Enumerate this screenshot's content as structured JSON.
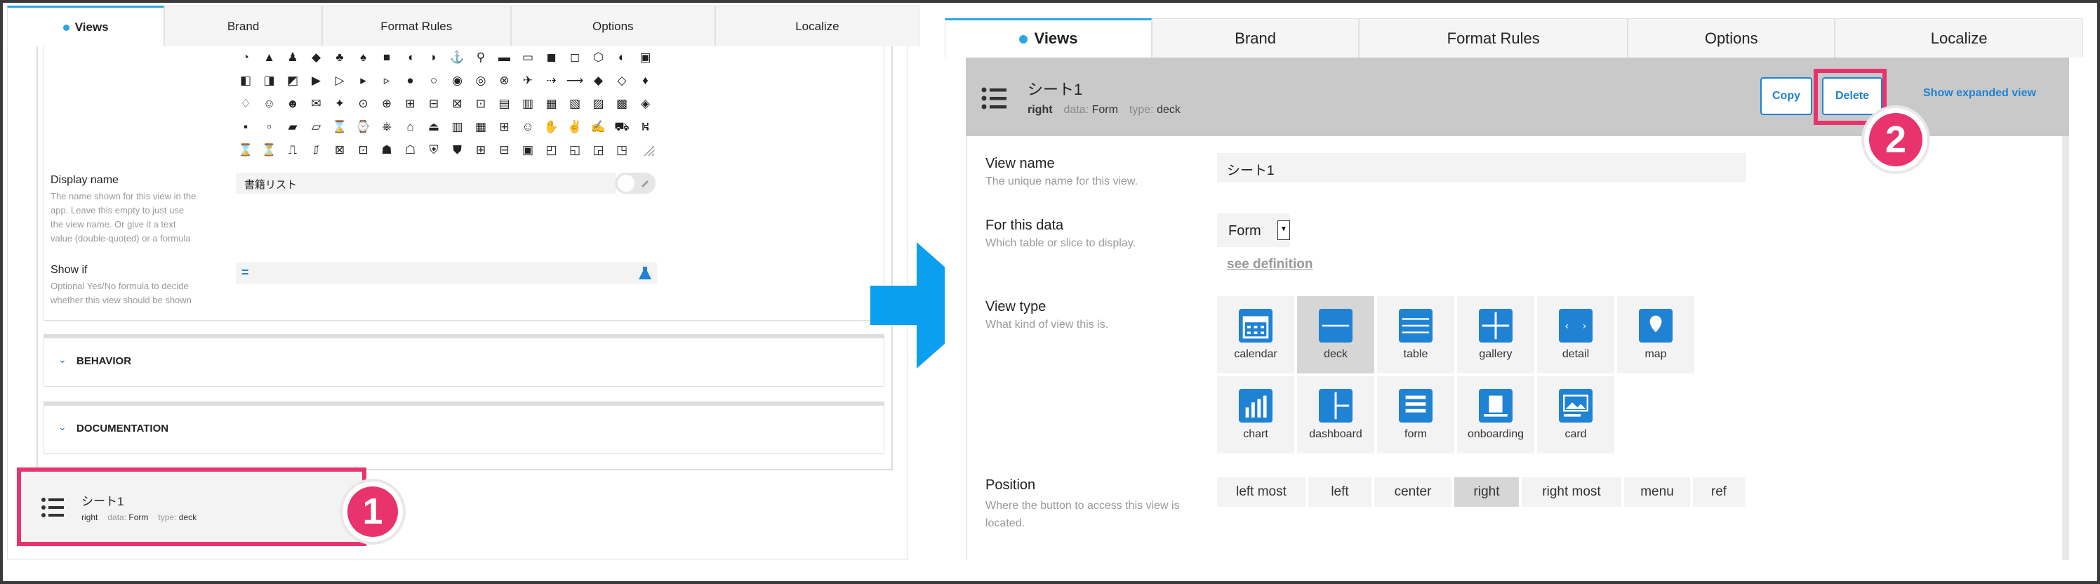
{
  "left": {
    "tabs": [
      {
        "label": "Views"
      },
      {
        "label": "Brand"
      },
      {
        "label": "Format Rules"
      },
      {
        "label": "Options"
      },
      {
        "label": "Localize"
      }
    ],
    "display_name": {
      "label": "Display name",
      "hint": "The name shown for this view in the app. Leave this empty to just use the view name. Or give it a text value (double-quoted) or a formula",
      "value": "書籍リスト"
    },
    "show_if": {
      "label": "Show if",
      "hint": "Optional Yes/No formula to decide whether this view should be shown",
      "eq": "="
    },
    "behavior": {
      "label": "BEHAVIOR"
    },
    "documentation": {
      "label": "DOCUMENTATION"
    },
    "view_item": {
      "title": "シート1",
      "position": "right",
      "data_label": "data:",
      "data_value": "Form",
      "type_label": "type:",
      "type_value": "deck"
    },
    "callout_number": "1"
  },
  "right": {
    "tabs": [
      {
        "label": "Views"
      },
      {
        "label": "Brand"
      },
      {
        "label": "Format Rules"
      },
      {
        "label": "Options"
      },
      {
        "label": "Localize"
      }
    ],
    "header": {
      "title": "シート1",
      "position": "right",
      "data_label": "data:",
      "data_value": "Form",
      "type_label": "type:",
      "type_value": "deck",
      "copy": "Copy",
      "delete": "Delete",
      "expanded": "Show expanded view"
    },
    "view_name": {
      "label": "View name",
      "hint": "The unique name for this view.",
      "value": "シート1"
    },
    "for_this_data": {
      "label": "For this data",
      "hint": "Which table or slice to display.",
      "value": "Form",
      "link": "see definition"
    },
    "view_type": {
      "label": "View type",
      "hint": "What kind of view this is.",
      "selected": "deck",
      "options": [
        {
          "label": "calendar"
        },
        {
          "label": "deck"
        },
        {
          "label": "table"
        },
        {
          "label": "gallery"
        },
        {
          "label": "detail"
        },
        {
          "label": "map"
        },
        {
          "label": "chart"
        },
        {
          "label": "dashboard"
        },
        {
          "label": "form"
        },
        {
          "label": "onboarding"
        },
        {
          "label": "card"
        }
      ]
    },
    "position": {
      "label": "Position",
      "hint": "Where the button to access this view is located.",
      "selected": "right",
      "options": [
        {
          "label": "left most"
        },
        {
          "label": "left"
        },
        {
          "label": "center"
        },
        {
          "label": "right"
        },
        {
          "label": "right most"
        },
        {
          "label": "menu"
        },
        {
          "label": "ref"
        }
      ]
    },
    "callout_number": "2"
  },
  "colors": {
    "accent": "#29a7e0",
    "highlight": "#e8336d",
    "icon": "#1f82d3",
    "arrow": "#0aa0ef"
  }
}
